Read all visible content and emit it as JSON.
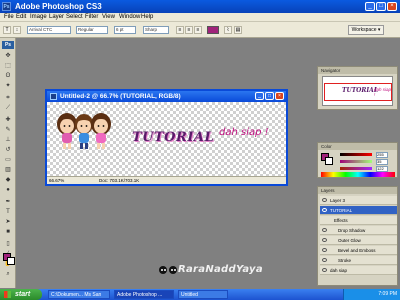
{
  "window": {
    "title": "Adobe Photoshop CS3",
    "badge": "Ps",
    "minimize": "_",
    "maximize": "□",
    "close": "×"
  },
  "menu": [
    "File",
    "Edit",
    "Image",
    "Layer",
    "Select",
    "Filter",
    "View",
    "Window",
    "Help"
  ],
  "options": {
    "font_family": "Arrival CTC",
    "font_style": "Regular",
    "font_size": "6 pt",
    "antialias": "Sharp",
    "text_color": "#a0237a",
    "workspace": "Workspace ▾"
  },
  "toolbox": {
    "badge": "Ps",
    "fg_color": "#a0237a",
    "bg_color": "#ffffff"
  },
  "document": {
    "title": "Untitled-2 @ 66.7% (TUTORIAL, RGB/8)",
    "text_tutorial": "TUTORIAL",
    "text_dah": "dah siap !",
    "status_zoom": "66.67%",
    "status_doc": "Doc: 703.1K/703.1K"
  },
  "panels": {
    "navigator_tab": "Navigator",
    "nav_text_tutorial": "TUTORIAL",
    "nav_text_dah": "dah siap !",
    "color_tab": "Color",
    "color_values": [
      "255",
      "35",
      "122"
    ],
    "layers_tab": "Layers",
    "layer_rows": [
      "Layer 3",
      "TUTORIAL",
      "Effects",
      "Drop Shadow",
      "Outer Glow",
      "Bevel and Emboss",
      "Stroke",
      "dah siap"
    ]
  },
  "watermark": "RaraNaddYaya",
  "taskbar": {
    "start": "start",
    "tasks": [
      "C:\\Dokumen... Ms San",
      "Adobe Photoshop ...",
      "Untitled"
    ],
    "time": "7:09 PM"
  }
}
